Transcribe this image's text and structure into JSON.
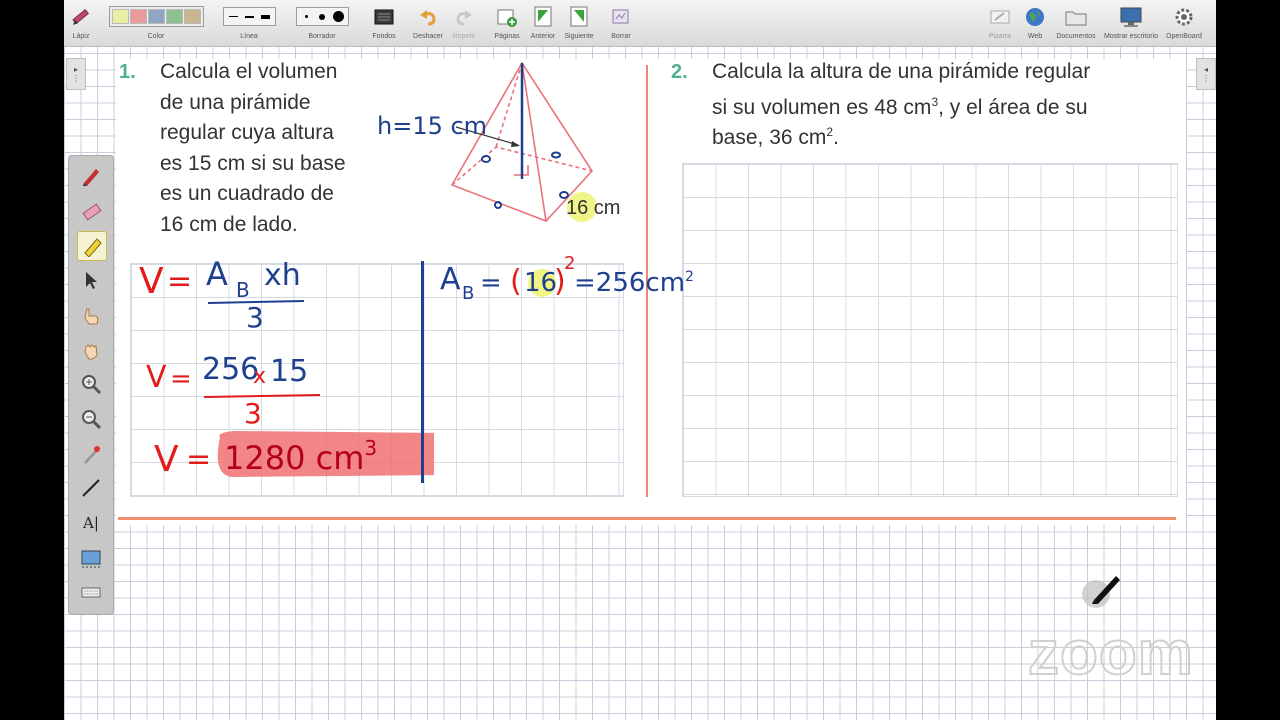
{
  "toolbar": {
    "pencil_label": "Lápiz",
    "color_label": "Color",
    "line_label": "Línea",
    "eraser_label": "Borrador",
    "backgrounds_label": "Fondos",
    "undo_label": "Deshacer",
    "redo_label": "Repetir",
    "pages_label": "Páginas",
    "previous_label": "Anterior",
    "next_label": "Siguiente",
    "erase_label": "Borrar",
    "board_label": "Pizarra",
    "web_label": "Web",
    "documents_label": "Documentos",
    "desktop_label": "Mostrar escritorio",
    "openboard_label": "OpenBoard",
    "colors": [
      "#e9f0a6",
      "#ea9a9a",
      "#8ea6c4",
      "#8fc08f",
      "#c8b68f"
    ]
  },
  "problem1": {
    "number": "1.",
    "lines": [
      "Calcula el volumen",
      "de una pirámide",
      "regular cuya altura",
      "es 15 cm si su base",
      "es un cuadrado de",
      "16 cm de lado."
    ],
    "height_label": "h=15 cm",
    "side_label": "16 cm"
  },
  "problem2": {
    "number": "2.",
    "line1": "Calcula la altura de una pirámide regular",
    "line2_a": "si su volumen es 48 cm",
    "line2_sup": "3",
    "line2_b": ", y el área de su",
    "line3_a": "base, 36 cm",
    "line3_sup": "2",
    "line3_b": "."
  },
  "handwriting": {
    "v": "V",
    "eq": "=",
    "ab": "A",
    "ab_sub": "B",
    "times_h": "xh",
    "three": "3",
    "num1": "256",
    "times": "x",
    "num2": "15",
    "result": "1280 cm",
    "result_sup": "3",
    "area_lhs": "A",
    "area_sub": "B",
    "area_eq": "=",
    "area_open": "(",
    "area_sixteen": "16",
    "area_close": ")",
    "area_exp": "2",
    "area_rhs": "=256cm",
    "area_rhs_sup": "2"
  },
  "watermark": "zoom"
}
